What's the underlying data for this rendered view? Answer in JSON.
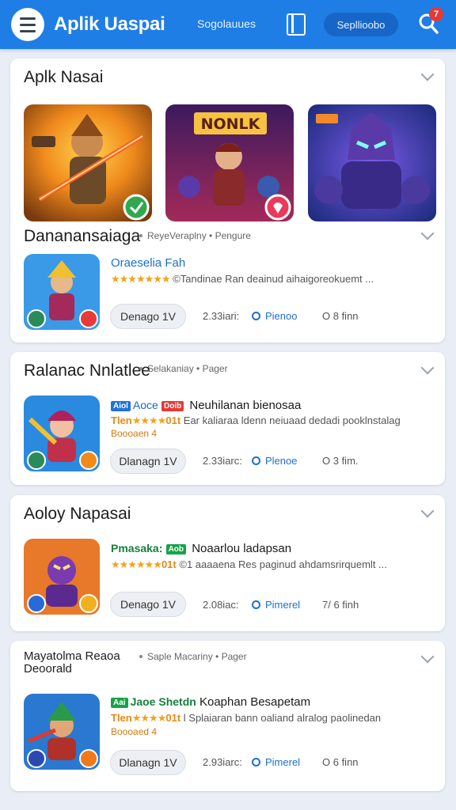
{
  "header": {
    "app_title": "Aplik Uaspai",
    "nav_link": "Sogolauues",
    "pill_button": "Sepllioobo",
    "badge": "7",
    "menu_icon": "hamburger-icon",
    "doc_icon": "document-icon",
    "search_icon": "search-icon",
    "accent": "#1e7ee6"
  },
  "featured": {
    "title": "Aplk Nasai",
    "items": [
      {
        "icon": "game-hero-icon",
        "badge": "check-badge"
      },
      {
        "icon": "game-nonlk-icon",
        "banner": "NONLK",
        "badge": "heart-badge"
      },
      {
        "icon": "game-robot-icon"
      }
    ]
  },
  "sections": [
    {
      "title": "Dananansaiaga",
      "meta": "ReyeVeraplny • Pengure",
      "app": {
        "tags": [],
        "name": "Oraeselia Fah",
        "stars": "★★★★★★★",
        "rating_prefix": "",
        "rating_text": "©Tandinae Ran deainud aihaigoreokuemt ...",
        "sub": "",
        "button": "Denago 1V",
        "downloads": "2.33iari:",
        "category": "Pienoo",
        "time": "O 8 finn"
      }
    },
    {
      "title": "Ralanac Nnlatlee",
      "meta": "Selakaniay • Pager",
      "app": {
        "tags": [
          {
            "text": "Aiol",
            "color": "blue"
          },
          {
            "text": "Aoce",
            "color": "label-blue"
          },
          {
            "text": "Doib",
            "color": "red"
          }
        ],
        "name": "Neuhilanan bienosaa",
        "stars": "★★★★",
        "rating_prefix": "Tlen",
        "rating_suffix": "01t",
        "rating_text": "Ear kaliaraa ldenn neiuaad dedadi pooklnstalag",
        "sub": "Boooaen 4",
        "button": "Dlanagn 1V",
        "downloads": "2.33iarc:",
        "category": "Plenoe",
        "time": "O 3 fim."
      }
    },
    {
      "title": "Aoloy Napasai",
      "meta": "",
      "app": {
        "tags": [
          {
            "text": "Pmasaka:",
            "color": "label-green"
          },
          {
            "text": "Aob",
            "color": "green"
          }
        ],
        "name": "Noaarlou ladapsan",
        "stars": "★★★★★★",
        "rating_prefix": "",
        "rating_suffix": "01t",
        "rating_text": "©1 aaaaena Res paginud ahdamsrirquemlt ...",
        "sub": "",
        "button": "Denago 1V",
        "downloads": "2.08iac:",
        "category": "Pimerel",
        "time": "7/ 6 finh"
      }
    },
    {
      "title": "Mayatolma Reaoa\nDeoorald",
      "meta": "Saple Macariny • Pager",
      "app": {
        "tags": [
          {
            "text": "Aai",
            "color": "green"
          },
          {
            "text": "Jaoe Shetdn",
            "color": "label-green"
          }
        ],
        "name": "Koaphan Besapetam",
        "stars": "★★★★",
        "rating_prefix": "Tlen",
        "rating_suffix": "01t",
        "rating_text": "l Splaiaran bann oaliand alralog paolinedan",
        "sub": "Boooaed 4",
        "button": "Dlanagn 1V",
        "downloads": "2.93iarc:",
        "category": "Pimerel",
        "time": "O 6 finn"
      }
    }
  ]
}
